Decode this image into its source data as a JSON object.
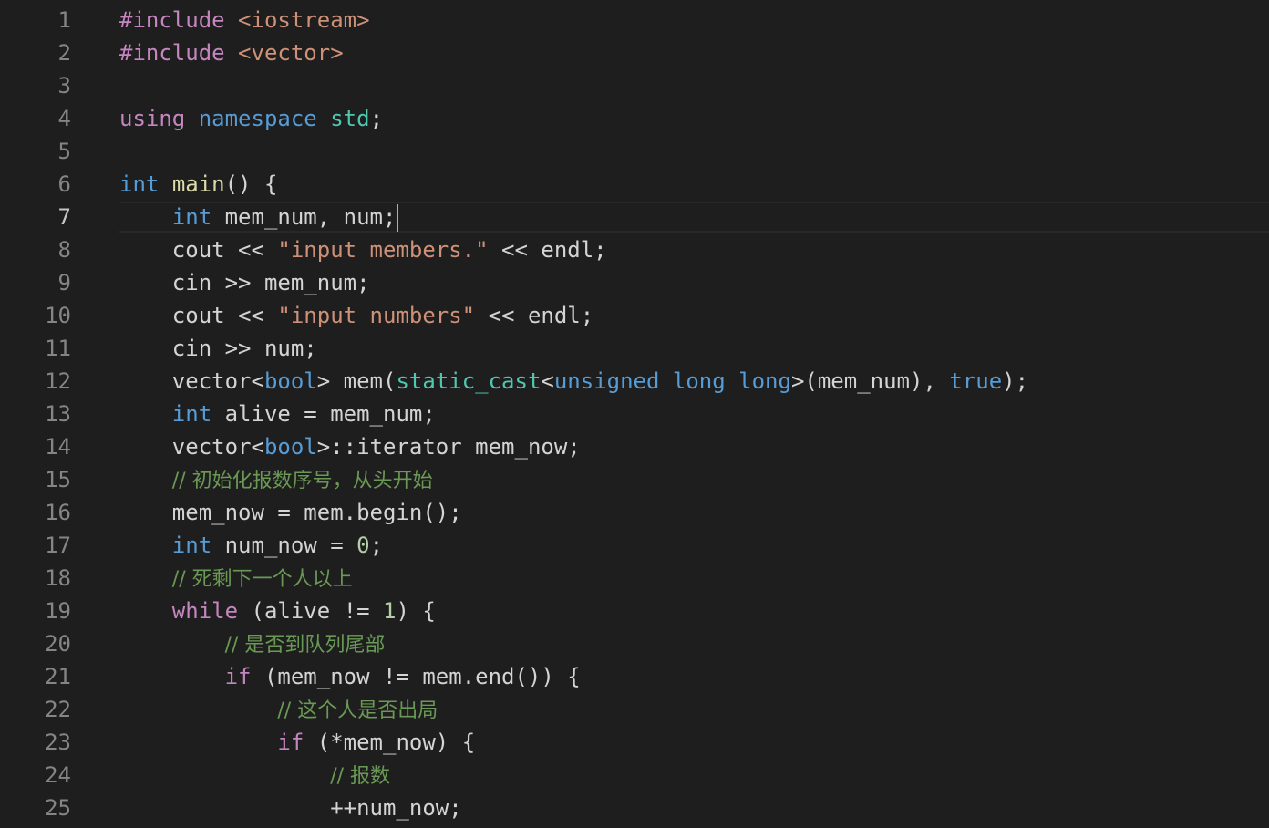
{
  "editor": {
    "language": "cpp",
    "cursor_line": 7,
    "lines": [
      {
        "n": "1",
        "tokens": [
          {
            "c": "ctl",
            "t": "#include "
          },
          {
            "c": "str",
            "t": "<iostream>"
          }
        ]
      },
      {
        "n": "2",
        "tokens": [
          {
            "c": "ctl",
            "t": "#include "
          },
          {
            "c": "str",
            "t": "<vector>"
          }
        ]
      },
      {
        "n": "3",
        "tokens": []
      },
      {
        "n": "4",
        "tokens": [
          {
            "c": "ctl",
            "t": "using"
          },
          {
            "c": "txt",
            "t": " "
          },
          {
            "c": "kw",
            "t": "namespace"
          },
          {
            "c": "txt",
            "t": " "
          },
          {
            "c": "typ",
            "t": "std"
          },
          {
            "c": "txt",
            "t": ";"
          }
        ]
      },
      {
        "n": "5",
        "tokens": []
      },
      {
        "n": "6",
        "tokens": [
          {
            "c": "kw",
            "t": "int"
          },
          {
            "c": "txt",
            "t": " "
          },
          {
            "c": "fn",
            "t": "main"
          },
          {
            "c": "txt",
            "t": "() {"
          }
        ]
      },
      {
        "n": "7",
        "tokens": [
          {
            "c": "txt",
            "t": "    "
          },
          {
            "c": "kw",
            "t": "int"
          },
          {
            "c": "txt",
            "t": " mem_num, num;"
          }
        ]
      },
      {
        "n": "8",
        "tokens": [
          {
            "c": "txt",
            "t": "    cout << "
          },
          {
            "c": "str",
            "t": "\"input members.\""
          },
          {
            "c": "txt",
            "t": " << endl;"
          }
        ]
      },
      {
        "n": "9",
        "tokens": [
          {
            "c": "txt",
            "t": "    cin >> mem_num;"
          }
        ]
      },
      {
        "n": "10",
        "tokens": [
          {
            "c": "txt",
            "t": "    cout << "
          },
          {
            "c": "str",
            "t": "\"input numbers\""
          },
          {
            "c": "txt",
            "t": " << endl;"
          }
        ]
      },
      {
        "n": "11",
        "tokens": [
          {
            "c": "txt",
            "t": "    cin >> num;"
          }
        ]
      },
      {
        "n": "12",
        "tokens": [
          {
            "c": "txt",
            "t": "    vector<"
          },
          {
            "c": "kw",
            "t": "bool"
          },
          {
            "c": "txt",
            "t": "> mem("
          },
          {
            "c": "typ",
            "t": "static_cast"
          },
          {
            "c": "txt",
            "t": "<"
          },
          {
            "c": "kw",
            "t": "unsigned long long"
          },
          {
            "c": "txt",
            "t": ">(mem_num), "
          },
          {
            "c": "kw",
            "t": "true"
          },
          {
            "c": "txt",
            "t": ");"
          }
        ]
      },
      {
        "n": "13",
        "tokens": [
          {
            "c": "txt",
            "t": "    "
          },
          {
            "c": "kw",
            "t": "int"
          },
          {
            "c": "txt",
            "t": " alive = mem_num;"
          }
        ]
      },
      {
        "n": "14",
        "tokens": [
          {
            "c": "txt",
            "t": "    vector<"
          },
          {
            "c": "kw",
            "t": "bool"
          },
          {
            "c": "txt",
            "t": ">::iterator mem_now;"
          }
        ]
      },
      {
        "n": "15",
        "tokens": [
          {
            "c": "txt",
            "t": "    "
          },
          {
            "c": "cmt",
            "t": "// 初始化报数序号，从头开始"
          }
        ]
      },
      {
        "n": "16",
        "tokens": [
          {
            "c": "txt",
            "t": "    mem_now = mem.begin();"
          }
        ]
      },
      {
        "n": "17",
        "tokens": [
          {
            "c": "txt",
            "t": "    "
          },
          {
            "c": "kw",
            "t": "int"
          },
          {
            "c": "txt",
            "t": " num_now = "
          },
          {
            "c": "num",
            "t": "0"
          },
          {
            "c": "txt",
            "t": ";"
          }
        ]
      },
      {
        "n": "18",
        "tokens": [
          {
            "c": "txt",
            "t": "    "
          },
          {
            "c": "cmt",
            "t": "// 死剩下一个人以上"
          }
        ]
      },
      {
        "n": "19",
        "tokens": [
          {
            "c": "txt",
            "t": "    "
          },
          {
            "c": "ctl",
            "t": "while"
          },
          {
            "c": "txt",
            "t": " (alive != "
          },
          {
            "c": "num",
            "t": "1"
          },
          {
            "c": "txt",
            "t": ") {"
          }
        ]
      },
      {
        "n": "20",
        "tokens": [
          {
            "c": "txt",
            "t": "        "
          },
          {
            "c": "cmt",
            "t": "// 是否到队列尾部"
          }
        ]
      },
      {
        "n": "21",
        "tokens": [
          {
            "c": "txt",
            "t": "        "
          },
          {
            "c": "ctl",
            "t": "if"
          },
          {
            "c": "txt",
            "t": " (mem_now != mem.end()) {"
          }
        ]
      },
      {
        "n": "22",
        "tokens": [
          {
            "c": "txt",
            "t": "            "
          },
          {
            "c": "cmt",
            "t": "// 这个人是否出局"
          }
        ]
      },
      {
        "n": "23",
        "tokens": [
          {
            "c": "txt",
            "t": "            "
          },
          {
            "c": "ctl",
            "t": "if"
          },
          {
            "c": "txt",
            "t": " (*mem_now) {"
          }
        ]
      },
      {
        "n": "24",
        "tokens": [
          {
            "c": "txt",
            "t": "                "
          },
          {
            "c": "cmt",
            "t": "// 报数"
          }
        ]
      },
      {
        "n": "25",
        "tokens": [
          {
            "c": "txt",
            "t": "                ++num_now;"
          }
        ]
      }
    ]
  }
}
